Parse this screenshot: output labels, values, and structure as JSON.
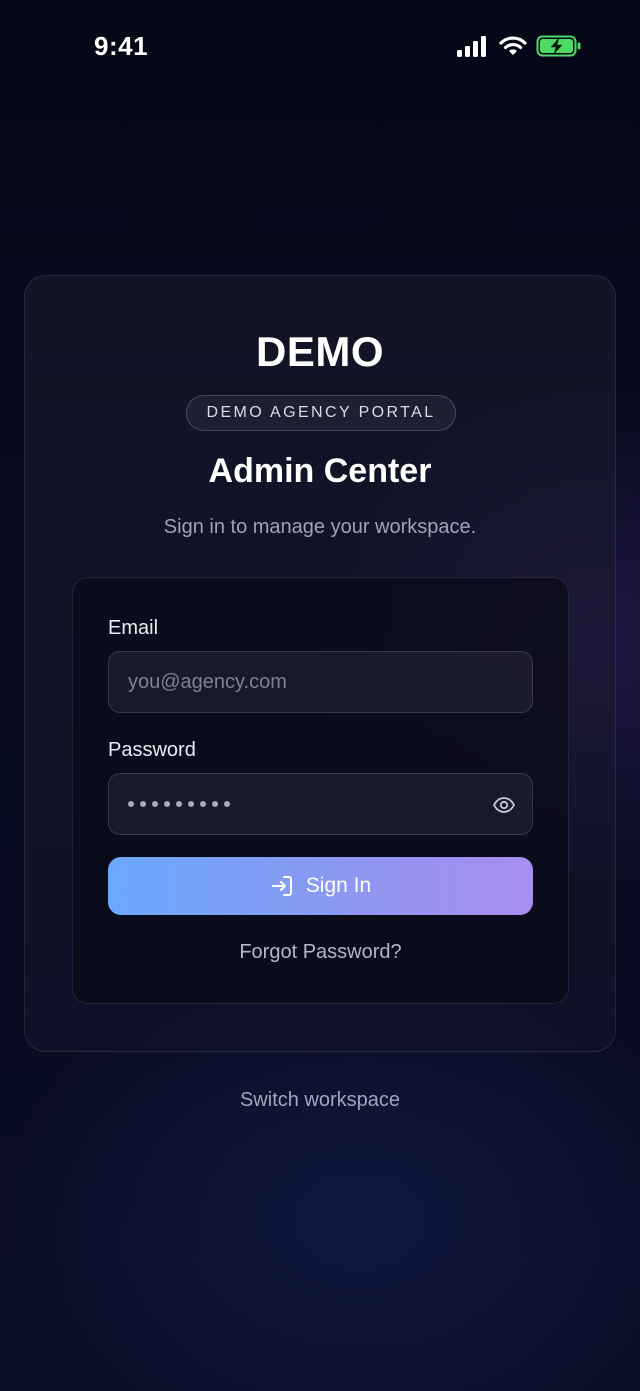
{
  "status_bar": {
    "time": "9:41",
    "icons": [
      "signal-icon",
      "wifi-icon",
      "battery-charging-icon"
    ],
    "battery_color": "#4cd964"
  },
  "card": {
    "brand": "DEMO",
    "portal_badge": "DEMO AGENCY PORTAL",
    "title": "Admin Center",
    "subtitle": "Sign in to manage your workspace."
  },
  "form": {
    "email_label": "Email",
    "email_placeholder": "you@agency.com",
    "email_value": "",
    "password_label": "Password",
    "password_masked_length": 9,
    "password_toggle_icon": "eye-icon",
    "submit_label": "Sign In",
    "submit_icon": "sign-in-icon",
    "submit_gradient": [
      "#6aa8ff",
      "#a98cf0"
    ],
    "forgot_label": "Forgot Password?"
  },
  "footer": {
    "switch_workspace_label": "Switch workspace"
  }
}
